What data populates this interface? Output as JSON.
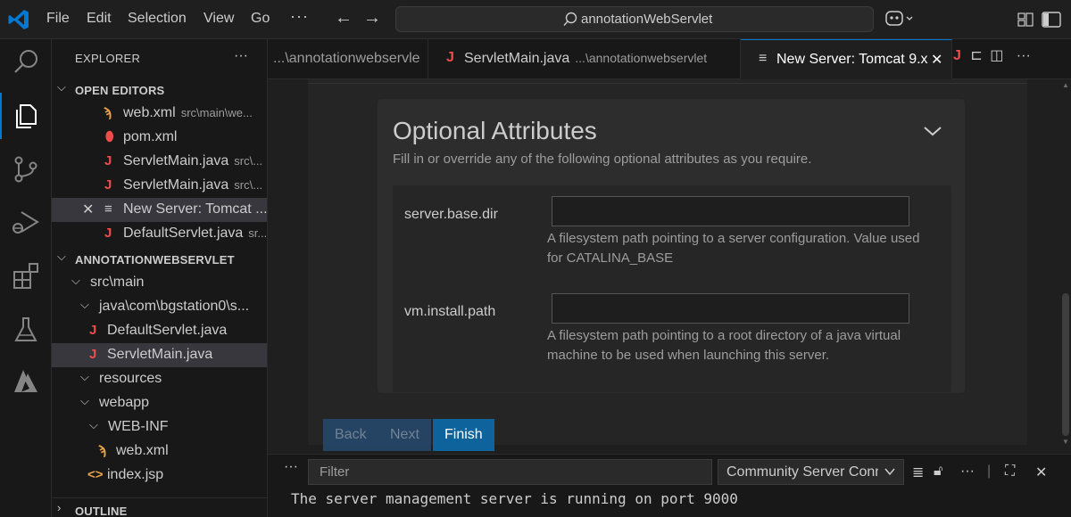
{
  "titlebar": {
    "menu": [
      "File",
      "Edit",
      "Selection",
      "View",
      "Go"
    ],
    "more": "···",
    "back": "←",
    "forward": "→",
    "command_center": "annotationWebServlet"
  },
  "activity_bar": {
    "items": [
      "explorer-icon",
      "search-icon",
      "source-control-icon",
      "run-debug-icon",
      "extensions-icon",
      "testing-icon",
      "azure-icon"
    ],
    "active": "explorer-icon",
    "accent_color": "#0078d4"
  },
  "sidebar": {
    "header": "EXPLORER",
    "more": "···",
    "open_editors_title": "OPEN EDITORS",
    "open_editors": [
      {
        "icon": "rss-icon",
        "name": "web.xml",
        "desc": "src\\main\\we..."
      },
      {
        "icon": "pin-icon",
        "name": "pom.xml",
        "desc": ""
      },
      {
        "icon": "java-icon",
        "name": "ServletMain.java",
        "desc": "src\\..."
      },
      {
        "icon": "java-icon",
        "name": "ServletMain.java",
        "desc": "src\\..."
      },
      {
        "icon": "list-icon",
        "name": "New Server: Tomcat ...",
        "desc": ""
      },
      {
        "icon": "java-icon",
        "name": "DefaultServlet.java",
        "desc": "sr..."
      }
    ],
    "project_title": "ANNOTATIONWEBSERVLET",
    "tree": [
      {
        "name": "src\\main"
      },
      {
        "name": "java\\com\\bgstation0\\s..."
      },
      {
        "name": "DefaultServlet.java"
      },
      {
        "name": "ServletMain.java"
      },
      {
        "name": "resources"
      },
      {
        "name": "webapp"
      },
      {
        "name": "WEB-INF"
      },
      {
        "name": "web.xml"
      },
      {
        "name": "index.jsp"
      }
    ],
    "outline_title": "OUTLINE"
  },
  "tabs": [
    {
      "label": "...\\annotationwebservle",
      "desc": "",
      "active": false
    },
    {
      "label": "ServletMain.java",
      "desc": "...\\annotationwebservlet",
      "active": false
    },
    {
      "label": "New Server: Tomcat 9.x",
      "desc": "",
      "active": true
    }
  ],
  "tab_actions": "J ⊏ ◫ ···",
  "editor": {
    "section_title": "Optional Attributes",
    "section_subtitle": "Fill in or override any of the following optional attributes as you require.",
    "attributes": [
      {
        "label": "server.base.dir",
        "value": "",
        "help": "A filesystem path pointing to a server configuration. Value used for CATALINA_BASE"
      },
      {
        "label": "vm.install.path",
        "value": "",
        "help": "A filesystem path pointing to a root directory of a java virtual machine to be used when launching this server."
      }
    ],
    "buttons": {
      "back": "Back",
      "next": "Next",
      "finish": "Finish"
    }
  },
  "panel": {
    "more": "···",
    "filter_placeholder": "Filter",
    "channel": "Community Server Connector",
    "output": "The server management server is running on port 9000"
  }
}
